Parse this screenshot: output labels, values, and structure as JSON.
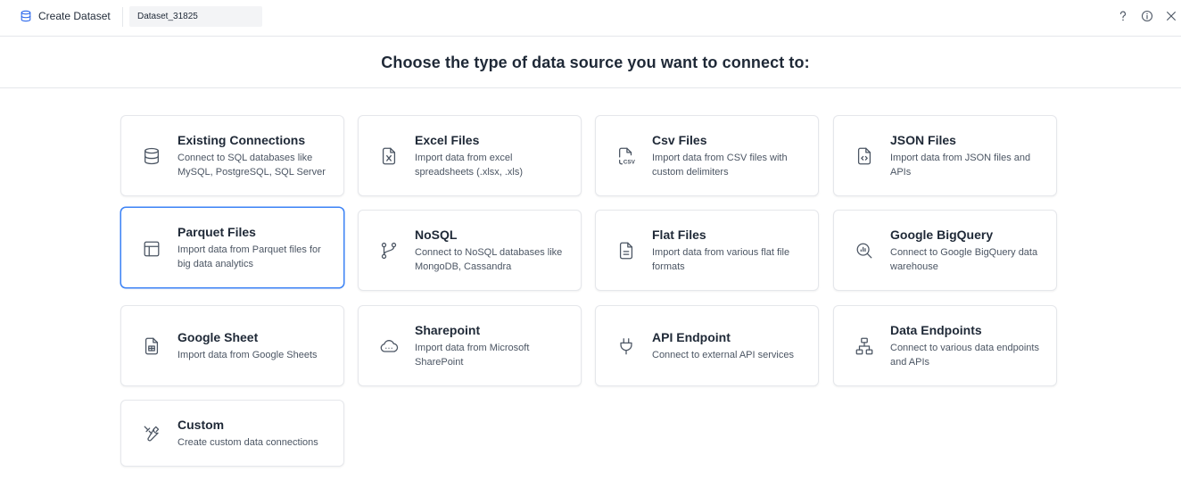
{
  "header": {
    "app_title": "Create Dataset",
    "dataset_name": "Dataset_31825"
  },
  "page": {
    "heading": "Choose the type of data source you want to connect to:"
  },
  "selected_source": "Parquet Files",
  "sources": [
    {
      "title": "Existing Connections",
      "description": "Connect to SQL databases like MySQL, PostgreSQL, SQL Server",
      "icon": "database-icon"
    },
    {
      "title": "Excel Files",
      "description": "Import data from excel spreadsheets (.xlsx, .xls)",
      "icon": "excel-file-icon"
    },
    {
      "title": "Csv Files",
      "description": "Import data from CSV files with custom delimiters",
      "icon": "csv-file-icon",
      "icon_text": "CSV"
    },
    {
      "title": "JSON Files",
      "description": "Import data from JSON files and APIs",
      "icon": "json-file-icon"
    },
    {
      "title": "Parquet Files",
      "description": "Import data from Parquet files for big data analytics",
      "icon": "layout-panel-icon"
    },
    {
      "title": "NoSQL",
      "description": "Connect to NoSQL databases like MongoDB, Cassandra",
      "icon": "git-branch-icon"
    },
    {
      "title": "Flat Files",
      "description": "Import data from various flat file formats",
      "icon": "text-file-icon"
    },
    {
      "title": "Google BigQuery",
      "description": "Connect to Google BigQuery data warehouse",
      "icon": "search-chart-icon"
    },
    {
      "title": "Google Sheet",
      "description": "Import data from Google Sheets",
      "icon": "sheet-file-icon"
    },
    {
      "title": "Sharepoint",
      "description": "Import data from Microsoft SharePoint",
      "icon": "cloud-icon"
    },
    {
      "title": "API Endpoint",
      "description": "Connect to external API services",
      "icon": "plug-icon"
    },
    {
      "title": "Data Endpoints",
      "description": "Connect to various data endpoints and APIs",
      "icon": "network-icon"
    },
    {
      "title": "Custom",
      "description": "Create custom data connections",
      "icon": "tools-icon"
    }
  ],
  "colors": {
    "text": "#1f2937",
    "muted_text": "#4b5563",
    "border": "#e5e7eb",
    "selected_border": "#3b82f6"
  }
}
